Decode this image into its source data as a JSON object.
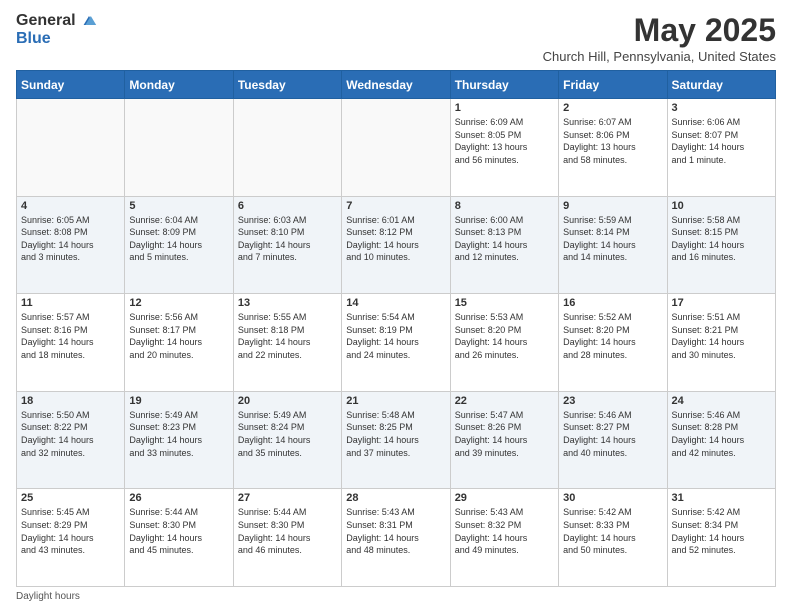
{
  "header": {
    "logo_general": "General",
    "logo_blue": "Blue",
    "month_title": "May 2025",
    "location": "Church Hill, Pennsylvania, United States"
  },
  "days_of_week": [
    "Sunday",
    "Monday",
    "Tuesday",
    "Wednesday",
    "Thursday",
    "Friday",
    "Saturday"
  ],
  "weeks": [
    [
      {
        "day": "",
        "info": ""
      },
      {
        "day": "",
        "info": ""
      },
      {
        "day": "",
        "info": ""
      },
      {
        "day": "",
        "info": ""
      },
      {
        "day": "1",
        "info": "Sunrise: 6:09 AM\nSunset: 8:05 PM\nDaylight: 13 hours\nand 56 minutes."
      },
      {
        "day": "2",
        "info": "Sunrise: 6:07 AM\nSunset: 8:06 PM\nDaylight: 13 hours\nand 58 minutes."
      },
      {
        "day": "3",
        "info": "Sunrise: 6:06 AM\nSunset: 8:07 PM\nDaylight: 14 hours\nand 1 minute."
      }
    ],
    [
      {
        "day": "4",
        "info": "Sunrise: 6:05 AM\nSunset: 8:08 PM\nDaylight: 14 hours\nand 3 minutes."
      },
      {
        "day": "5",
        "info": "Sunrise: 6:04 AM\nSunset: 8:09 PM\nDaylight: 14 hours\nand 5 minutes."
      },
      {
        "day": "6",
        "info": "Sunrise: 6:03 AM\nSunset: 8:10 PM\nDaylight: 14 hours\nand 7 minutes."
      },
      {
        "day": "7",
        "info": "Sunrise: 6:01 AM\nSunset: 8:12 PM\nDaylight: 14 hours\nand 10 minutes."
      },
      {
        "day": "8",
        "info": "Sunrise: 6:00 AM\nSunset: 8:13 PM\nDaylight: 14 hours\nand 12 minutes."
      },
      {
        "day": "9",
        "info": "Sunrise: 5:59 AM\nSunset: 8:14 PM\nDaylight: 14 hours\nand 14 minutes."
      },
      {
        "day": "10",
        "info": "Sunrise: 5:58 AM\nSunset: 8:15 PM\nDaylight: 14 hours\nand 16 minutes."
      }
    ],
    [
      {
        "day": "11",
        "info": "Sunrise: 5:57 AM\nSunset: 8:16 PM\nDaylight: 14 hours\nand 18 minutes."
      },
      {
        "day": "12",
        "info": "Sunrise: 5:56 AM\nSunset: 8:17 PM\nDaylight: 14 hours\nand 20 minutes."
      },
      {
        "day": "13",
        "info": "Sunrise: 5:55 AM\nSunset: 8:18 PM\nDaylight: 14 hours\nand 22 minutes."
      },
      {
        "day": "14",
        "info": "Sunrise: 5:54 AM\nSunset: 8:19 PM\nDaylight: 14 hours\nand 24 minutes."
      },
      {
        "day": "15",
        "info": "Sunrise: 5:53 AM\nSunset: 8:20 PM\nDaylight: 14 hours\nand 26 minutes."
      },
      {
        "day": "16",
        "info": "Sunrise: 5:52 AM\nSunset: 8:20 PM\nDaylight: 14 hours\nand 28 minutes."
      },
      {
        "day": "17",
        "info": "Sunrise: 5:51 AM\nSunset: 8:21 PM\nDaylight: 14 hours\nand 30 minutes."
      }
    ],
    [
      {
        "day": "18",
        "info": "Sunrise: 5:50 AM\nSunset: 8:22 PM\nDaylight: 14 hours\nand 32 minutes."
      },
      {
        "day": "19",
        "info": "Sunrise: 5:49 AM\nSunset: 8:23 PM\nDaylight: 14 hours\nand 33 minutes."
      },
      {
        "day": "20",
        "info": "Sunrise: 5:49 AM\nSunset: 8:24 PM\nDaylight: 14 hours\nand 35 minutes."
      },
      {
        "day": "21",
        "info": "Sunrise: 5:48 AM\nSunset: 8:25 PM\nDaylight: 14 hours\nand 37 minutes."
      },
      {
        "day": "22",
        "info": "Sunrise: 5:47 AM\nSunset: 8:26 PM\nDaylight: 14 hours\nand 39 minutes."
      },
      {
        "day": "23",
        "info": "Sunrise: 5:46 AM\nSunset: 8:27 PM\nDaylight: 14 hours\nand 40 minutes."
      },
      {
        "day": "24",
        "info": "Sunrise: 5:46 AM\nSunset: 8:28 PM\nDaylight: 14 hours\nand 42 minutes."
      }
    ],
    [
      {
        "day": "25",
        "info": "Sunrise: 5:45 AM\nSunset: 8:29 PM\nDaylight: 14 hours\nand 43 minutes."
      },
      {
        "day": "26",
        "info": "Sunrise: 5:44 AM\nSunset: 8:30 PM\nDaylight: 14 hours\nand 45 minutes."
      },
      {
        "day": "27",
        "info": "Sunrise: 5:44 AM\nSunset: 8:30 PM\nDaylight: 14 hours\nand 46 minutes."
      },
      {
        "day": "28",
        "info": "Sunrise: 5:43 AM\nSunset: 8:31 PM\nDaylight: 14 hours\nand 48 minutes."
      },
      {
        "day": "29",
        "info": "Sunrise: 5:43 AM\nSunset: 8:32 PM\nDaylight: 14 hours\nand 49 minutes."
      },
      {
        "day": "30",
        "info": "Sunrise: 5:42 AM\nSunset: 8:33 PM\nDaylight: 14 hours\nand 50 minutes."
      },
      {
        "day": "31",
        "info": "Sunrise: 5:42 AM\nSunset: 8:34 PM\nDaylight: 14 hours\nand 52 minutes."
      }
    ]
  ],
  "footer": {
    "note": "Daylight hours"
  }
}
